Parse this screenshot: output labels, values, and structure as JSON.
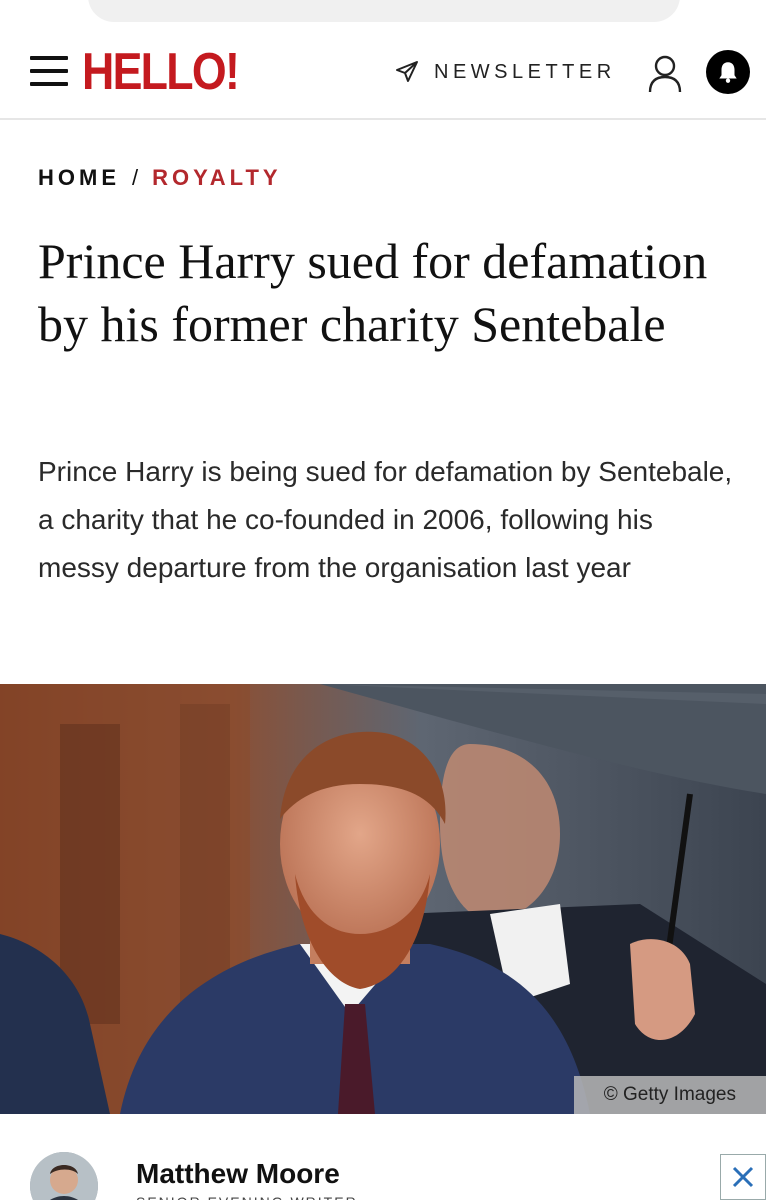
{
  "header": {
    "logo": "HELLO!",
    "newsletter_label": "NEWSLETTER",
    "brand_color": "#c41a1f"
  },
  "breadcrumb": {
    "home": "HOME",
    "separator": "/",
    "section": "ROYALTY",
    "section_color": "#b3282d"
  },
  "article": {
    "headline": "Prince Harry sued for defamation by his former charity Sentebale",
    "standfirst": "Prince Harry is being sued for defamation by Sentebale, a charity that he co-founded in 2006, following his messy departure from the organisation last year",
    "image_credit": "© Getty Images"
  },
  "author": {
    "name": "Matthew Moore",
    "role": "SENIOR EVENING WRITER"
  },
  "icons": {
    "menu": "hamburger-menu-icon",
    "newsletter": "send-icon",
    "account": "user-icon",
    "notifications": "bell-icon",
    "ad_close": "close-icon"
  }
}
